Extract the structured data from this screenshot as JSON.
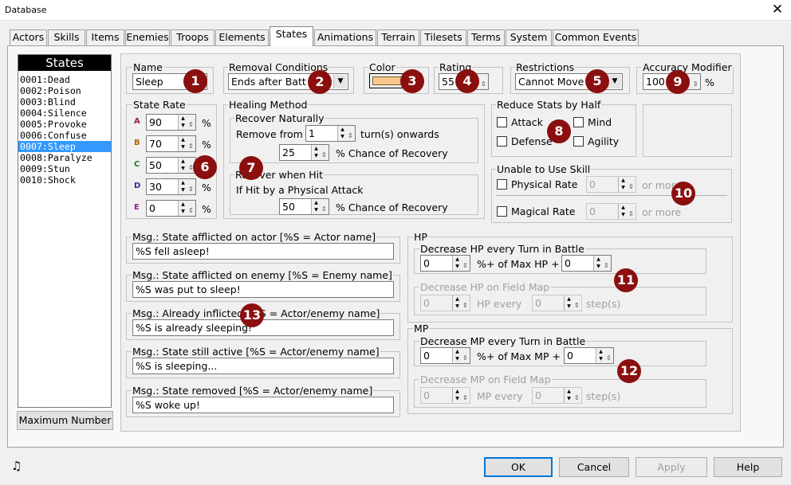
{
  "window": {
    "title": "Database",
    "close_icon": "close-icon"
  },
  "tabs": [
    "Actors",
    "Skills",
    "Items",
    "Enemies",
    "Troops",
    "Elements",
    "States",
    "Animations",
    "Terrain",
    "Tilesets",
    "Terms",
    "System",
    "Common Events"
  ],
  "active_tab": "States",
  "states_list": {
    "header": "States",
    "items": [
      "0001:Dead",
      "0002:Poison",
      "0003:Blind",
      "0004:Silence",
      "0005:Provoke",
      "0006:Confuse",
      "0007:Sleep",
      "0008:Paralyze",
      "0009:Stun",
      "0010:Shock"
    ],
    "selected": "0007:Sleep"
  },
  "max_button": "Maximum Number",
  "name": {
    "label": "Name",
    "value": "Sleep"
  },
  "removal": {
    "label": "Removal Conditions",
    "value": "Ends after Batt"
  },
  "color": {
    "label": "Color",
    "swatch": "#f8c88c"
  },
  "rating": {
    "label": "Rating",
    "value": "55"
  },
  "restrictions": {
    "label": "Restrictions",
    "value": "Cannot Move"
  },
  "accuracy": {
    "label": "Accuracy Modifier",
    "value": "100",
    "unit": "%"
  },
  "state_rate": {
    "label": "State Rate",
    "rows": [
      {
        "letter": "A",
        "color": "#9b1c5a",
        "value": "90"
      },
      {
        "letter": "B",
        "color": "#b06a00",
        "value": "70"
      },
      {
        "letter": "C",
        "color": "#207a20",
        "value": "50"
      },
      {
        "letter": "D",
        "color": "#2a2aa0",
        "value": "30"
      },
      {
        "letter": "E",
        "color": "#a0209a",
        "value": "0"
      }
    ],
    "unit": "%"
  },
  "healing": {
    "label": "Healing Method",
    "naturally": {
      "label": "Recover Naturally",
      "remove_from": "Remove from",
      "turns_value": "1",
      "turns_suffix": "turn(s) onwards",
      "chance_value": "25",
      "chance_suffix": "% Chance of Recovery"
    },
    "hit": {
      "label": "Recover when Hit",
      "desc": "If Hit by a Physical Attack",
      "chance_value": "50",
      "chance_suffix": "% Chance of Recovery"
    }
  },
  "reduce": {
    "label": "Reduce Stats by Half",
    "items": [
      "Attack",
      "Mind",
      "Defense",
      "Agility"
    ]
  },
  "unable": {
    "label": "Unable to Use Skill",
    "physical": "Physical Rate",
    "physical_value": "0",
    "magical": "Magical Rate",
    "magical_value": "0",
    "or_more": "or more"
  },
  "messages": [
    {
      "label": "Msg.: State afflicted on actor [%S = Actor name]",
      "value": "%S fell asleep!"
    },
    {
      "label": "Msg.: State afflicted on enemy [%S = Enemy name]",
      "value": "%S was put to sleep!"
    },
    {
      "label": "Msg.: Already inflicted [%S = Actor/enemy name]",
      "value": "%S is already sleeping!"
    },
    {
      "label": "Msg.: State still active [%S = Actor/enemy name]",
      "value": "%S is sleeping..."
    },
    {
      "label": "Msg.: State removed [%S = Actor/enemy name]",
      "value": "%S woke up!"
    }
  ],
  "hp": {
    "label": "HP",
    "battle": {
      "label": "Decrease HP every Turn in Battle",
      "v1": "0",
      "mid": "%+ of Max HP +",
      "v2": "0"
    },
    "field": {
      "label": "Decrease HP on Field Map",
      "v1": "0",
      "mid": "HP every",
      "v2": "0",
      "suffix": "step(s)"
    }
  },
  "mp": {
    "label": "MP",
    "battle": {
      "label": "Decrease MP every Turn in Battle",
      "v1": "0",
      "mid": "%+ of Max MP +",
      "v2": "0"
    },
    "field": {
      "label": "Decrease MP on Field Map",
      "v1": "0",
      "mid": "MP every",
      "v2": "0",
      "suffix": "step(s)"
    }
  },
  "callouts": [
    "1",
    "2",
    "3",
    "4",
    "5",
    "6",
    "7",
    "8",
    "9",
    "10",
    "11",
    "12",
    "13"
  ],
  "buttons": {
    "ok": "OK",
    "cancel": "Cancel",
    "apply": "Apply",
    "help": "Help"
  },
  "music_icon": "♫"
}
